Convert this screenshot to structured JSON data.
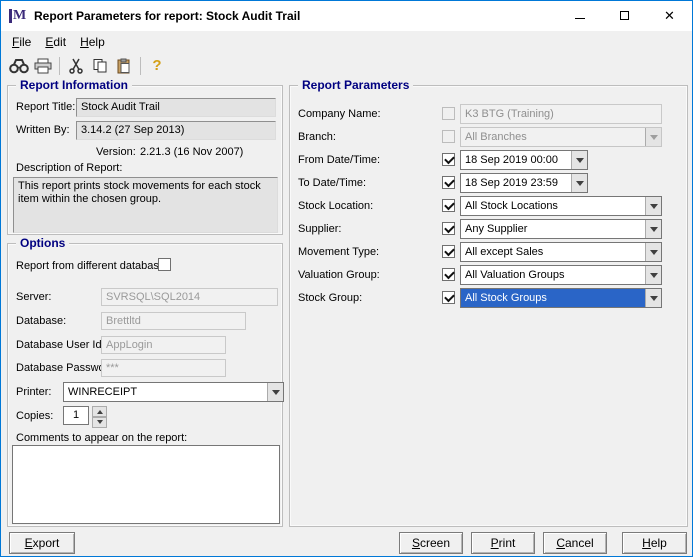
{
  "colors": {
    "group_title": "#000080",
    "selection_highlight": "#2a65c7",
    "window_border": "#0078d7"
  },
  "window": {
    "title": "Report Parameters for report: Stock Audit Trail",
    "logo_letter": "M",
    "controls": [
      "minimize",
      "maximize",
      "close"
    ]
  },
  "menu": {
    "items": [
      {
        "label": "File"
      },
      {
        "label": "Edit"
      },
      {
        "label": "Help"
      }
    ]
  },
  "toolbar": {
    "icons": [
      "find",
      "print",
      "cut",
      "copy",
      "paste",
      "help"
    ]
  },
  "report_information": {
    "title": "Report Information",
    "report_title": {
      "label": "Report Title:",
      "value": "Stock Audit Trail"
    },
    "written_by": {
      "label": "Written By:",
      "value": "3.14.2 (27 Sep 2013)"
    },
    "version": {
      "label": "Version:",
      "value": "2.21.3 (16 Nov 2007)"
    },
    "description": {
      "label": "Description of Report:",
      "value": "This report prints stock movements for each stock item within the chosen group."
    }
  },
  "options": {
    "title": "Options",
    "different_database": {
      "label": "Report from different database",
      "checked": false
    },
    "server": {
      "label": "Server:",
      "value": "SVRSQL\\SQL2014"
    },
    "database": {
      "label": "Database:",
      "value": "Brettltd"
    },
    "database_user": {
      "label": "Database User Id:",
      "value": "AppLogin"
    },
    "database_password": {
      "label": "Database Password:",
      "value": "***"
    },
    "printer": {
      "label": "Printer:",
      "value": "WINRECEIPT"
    },
    "copies": {
      "label": "Copies:",
      "value": "1"
    },
    "comments": {
      "label": "Comments to appear on the report:",
      "value": ""
    }
  },
  "report_parameters": {
    "title": "Report Parameters",
    "rows": [
      {
        "label": "Company Name:",
        "checked": false,
        "enabled": false,
        "control": "textbox",
        "value": "K3 BTG (Training)"
      },
      {
        "label": "Branch:",
        "checked": false,
        "enabled": false,
        "control": "dropdown",
        "value": "All Branches"
      },
      {
        "label": "From Date/Time:",
        "checked": true,
        "enabled": true,
        "control": "dropdown",
        "value": "18 Sep 2019 00:00"
      },
      {
        "label": "To Date/Time:",
        "checked": true,
        "enabled": true,
        "control": "dropdown",
        "value": "18 Sep 2019 23:59"
      },
      {
        "label": "Stock Location:",
        "checked": true,
        "enabled": true,
        "control": "dropdown",
        "value": "All Stock Locations"
      },
      {
        "label": "Supplier:",
        "checked": true,
        "enabled": true,
        "control": "dropdown",
        "value": "Any Supplier"
      },
      {
        "label": "Movement Type:",
        "checked": true,
        "enabled": true,
        "control": "dropdown",
        "value": "All except Sales"
      },
      {
        "label": "Valuation Group:",
        "checked": true,
        "enabled": true,
        "control": "dropdown",
        "value": "All Valuation Groups"
      },
      {
        "label": "Stock Group:",
        "checked": true,
        "enabled": true,
        "control": "dropdown",
        "value": "All Stock Groups",
        "selected": true
      }
    ]
  },
  "buttons": {
    "export": "Export",
    "screen": "Screen",
    "print": "Print",
    "cancel": "Cancel",
    "help": "Help"
  }
}
